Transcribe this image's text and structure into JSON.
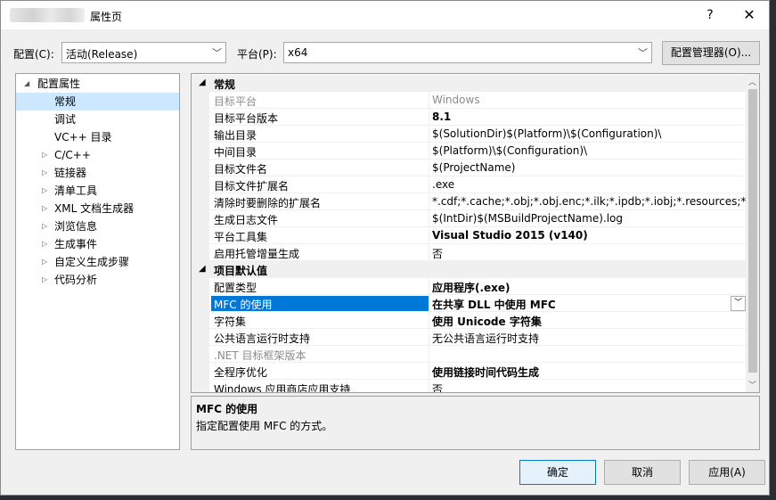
{
  "window": {
    "title": "属性页",
    "help_label": "?",
    "close_label": "✕"
  },
  "config_bar": {
    "config_label": "配置(C):",
    "config_value": "活动(Release)",
    "platform_label": "平台(P):",
    "platform_value": "x64",
    "manager_button": "配置管理器(O)..."
  },
  "tree": {
    "root": "配置属性",
    "items": [
      {
        "label": "常规",
        "selected": true
      },
      {
        "label": "调试"
      },
      {
        "label": "VC++ 目录"
      },
      {
        "label": "C/C++",
        "expandable": true
      },
      {
        "label": "链接器",
        "expandable": true
      },
      {
        "label": "清单工具",
        "expandable": true
      },
      {
        "label": "XML 文档生成器",
        "expandable": true
      },
      {
        "label": "浏览信息",
        "expandable": true
      },
      {
        "label": "生成事件",
        "expandable": true
      },
      {
        "label": "自定义生成步骤",
        "expandable": true
      },
      {
        "label": "代码分析",
        "expandable": true
      }
    ]
  },
  "grid": {
    "sections": [
      {
        "title": "常规",
        "rows": [
          {
            "name": "目标平台",
            "value": "Windows",
            "dim": true
          },
          {
            "name": "目标平台版本",
            "value": "8.1",
            "bold": true
          },
          {
            "name": "输出目录",
            "value": "$(SolutionDir)$(Platform)\\$(Configuration)\\"
          },
          {
            "name": "中间目录",
            "value": "$(Platform)\\$(Configuration)\\"
          },
          {
            "name": "目标文件名",
            "value": "$(ProjectName)"
          },
          {
            "name": "目标文件扩展名",
            "value": ".exe"
          },
          {
            "name": "清除时要删除的扩展名",
            "value": "*.cdf;*.cache;*.obj;*.obj.enc;*.ilk;*.ipdb;*.iobj;*.resources;*.tlb;*"
          },
          {
            "name": "生成日志文件",
            "value": "$(IntDir)$(MSBuildProjectName).log"
          },
          {
            "name": "平台工具集",
            "value": "Visual Studio 2015 (v140)",
            "bold": true
          },
          {
            "name": "启用托管增量生成",
            "value": "否"
          }
        ]
      },
      {
        "title": "项目默认值",
        "rows": [
          {
            "name": "配置类型",
            "value": "应用程序(.exe)",
            "bold": true
          },
          {
            "name": "MFC 的使用",
            "value": "在共享 DLL 中使用 MFC",
            "bold": true,
            "selected": true
          },
          {
            "name": "字符集",
            "value": "使用 Unicode 字符集",
            "bold": true
          },
          {
            "name": "公共语言运行时支持",
            "value": "无公共语言运行时支持"
          },
          {
            "name": ".NET 目标框架版本",
            "value": "",
            "dim": true
          },
          {
            "name": "全程序优化",
            "value": "使用链接时间代码生成",
            "bold": true
          },
          {
            "name": "Windows 应用商店应用支持",
            "value": "否"
          }
        ]
      }
    ]
  },
  "description": {
    "title": "MFC 的使用",
    "text": "指定配置使用 MFC 的方式。"
  },
  "buttons": {
    "ok": "确定",
    "cancel": "取消",
    "apply": "应用(A)"
  },
  "colors": {
    "selection": "#0078d7",
    "tree_selection": "#cce8ff"
  }
}
